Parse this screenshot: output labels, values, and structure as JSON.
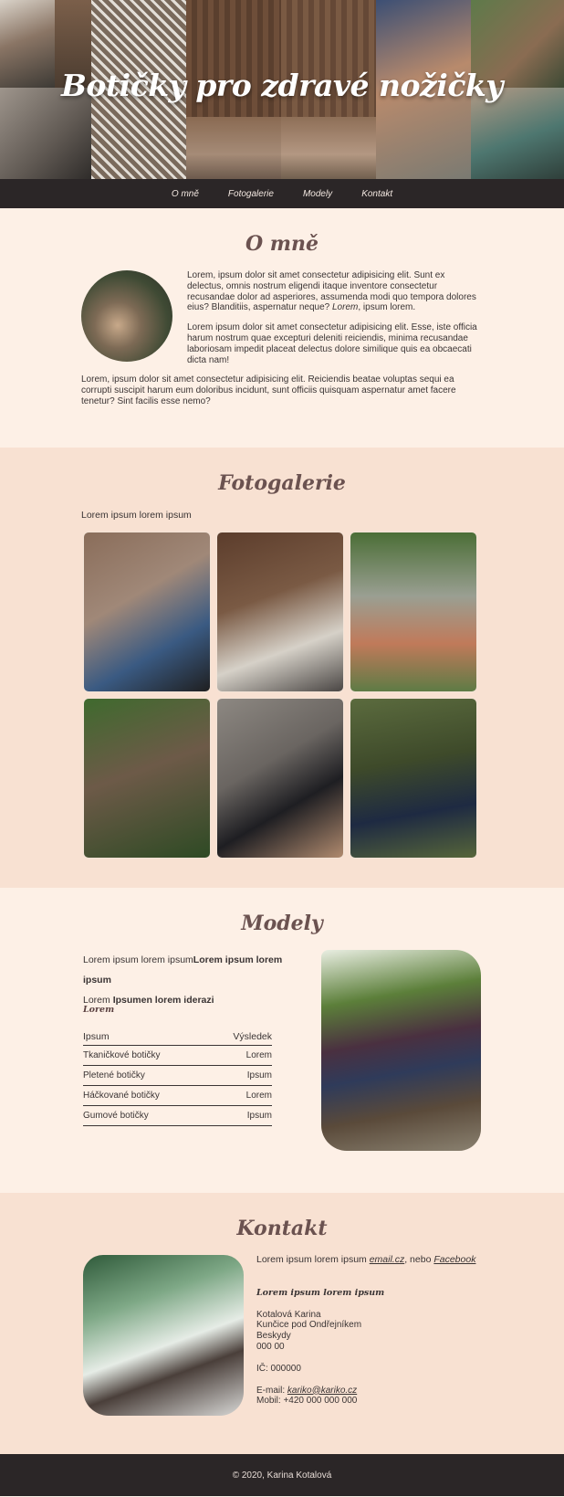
{
  "header": {
    "title": "Botičky pro zdravé nožičky"
  },
  "nav": {
    "items": [
      "O mně",
      "Fotogalerie",
      "Modely",
      "Kontakt"
    ]
  },
  "about": {
    "title": "O mně",
    "p1": "Lorem, ipsum dolor sit amet consectetur adipisicing elit. Sunt ex delectus, omnis nostrum eligendi itaque inventore consectetur recusandae dolor ad asperiores, assumenda modi quo tempora dolores eius? Blanditiis, aspernatur neque?",
    "p1_em": "Lorem",
    "p1_tail": ", ipsum lorem.",
    "p2": "Lorem ipsum dolor sit amet consectetur adipisicing elit. Esse, iste officia harum nostrum quae excepturi deleniti reiciendis, minima recusandae laboriosam impedit placeat delectus dolore similique quis ea obcaecati dicta nam!",
    "p3": "Lorem, ipsum dolor sit amet consectetur adipisicing elit. Reiciendis beatae voluptas sequi ea corrupti suscipit harum eum doloribus incidunt, sunt officiis quisquam aspernatur amet facere tenetur? Sint facilis esse nemo?"
  },
  "gallery": {
    "title": "Fotogalerie",
    "lead": "Lorem ipsum lorem ipsum"
  },
  "models": {
    "title": "Modely",
    "line1_plain": "Lorem ipsum lorem ipsum",
    "line1_bold": "Lorem ipsum lorem ipsum",
    "line2_plain": "Lorem ",
    "line2_bold": "Ipsumen lorem iderazi",
    "subtitle": "Lorem",
    "table": {
      "headers": [
        "Ipsum",
        "Výsledek"
      ],
      "rows": [
        [
          "Tkaničkové botičky",
          "Lorem"
        ],
        [
          "Pletené botičky",
          "Ipsum"
        ],
        [
          "Háčkované botičky",
          "Lorem"
        ],
        [
          "Gumové botičky",
          "Ipsum"
        ]
      ]
    }
  },
  "contact": {
    "title": "Kontakt",
    "lead": "Lorem ipsum lorem ipsum ",
    "lead_email": "email.cz",
    "lead_mid": ", nebo ",
    "lead_fb": "Facebook",
    "subtitle": "Lorem ipsum lorem ipsum",
    "address": [
      "Kotalová Karina",
      "Kunčice pod Ondřejníkem",
      "Beskydy",
      "000 00"
    ],
    "ico": "IČ: 000000",
    "email_label": "E-mail: ",
    "email": "kariko@kariko.cz",
    "phone": "Mobil: +420 000 000 000"
  },
  "footer": {
    "text": "© 2020, Karina Kotalová"
  }
}
